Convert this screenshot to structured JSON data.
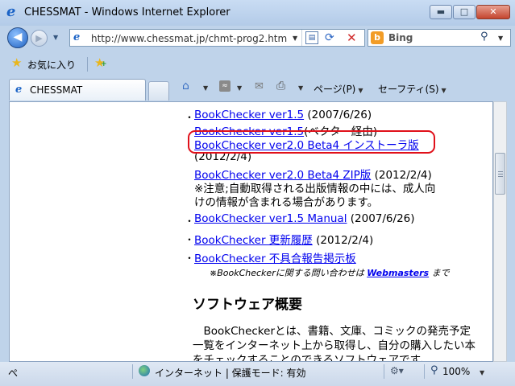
{
  "window": {
    "title": "CHESSMAT - Windows Internet Explorer",
    "min_glyph": "▬",
    "max_glyph": "□",
    "close_glyph": "✕"
  },
  "nav": {
    "address": "http://www.chessmat.jp/chmt-prog2.htm",
    "search_provider": "Bing"
  },
  "favorites": {
    "label": "お気に入り"
  },
  "tab": {
    "label": "CHESSMAT"
  },
  "commands": {
    "page": "ページ(P)",
    "safety": "セーフティ(S)"
  },
  "content": {
    "items": [
      {
        "link": "BookChecker ver1.5",
        "text": " (2007/6/26)"
      },
      {
        "link": "BookChecker ver1.5",
        "text": "(ベクター経由)"
      },
      {
        "link": "BookChecker ver2.0 Beta4 インストーラ版",
        "text": ""
      },
      {
        "date": "(2012/2/4)"
      },
      {
        "link": "BookChecker ver2.0 Beta4 ZIP版",
        "text": " (2012/2/4)"
      },
      {
        "note1": "※注意;自動取得される出版情報の中には、成人向",
        "note2": "けの情報が含まれる場合があります。"
      },
      {
        "link": "BookChecker ver1.5 Manual",
        "text": " (2007/6/26)"
      },
      {
        "link": "BookChecker 更新履歴",
        "text": " (2012/2/4)"
      },
      {
        "link": "BookChecker 不具合報告掲示板",
        "text": ""
      }
    ],
    "contact_pre": "※BookCheckerに関する問い合わせは ",
    "contact_link": "Webmasters",
    "contact_post": " まで",
    "heading": "ソフトウェア概要",
    "paragraph": "　BookCheckerとは、書籍、文庫、コミックの発売予定一覧をインターネット上から取得し、自分の購入したい本をチェックすることのできるソフトウェアです。"
  },
  "status": {
    "left": "ぺ",
    "zone": "インターネット | 保護モード: 有効",
    "zoom": "100%"
  }
}
